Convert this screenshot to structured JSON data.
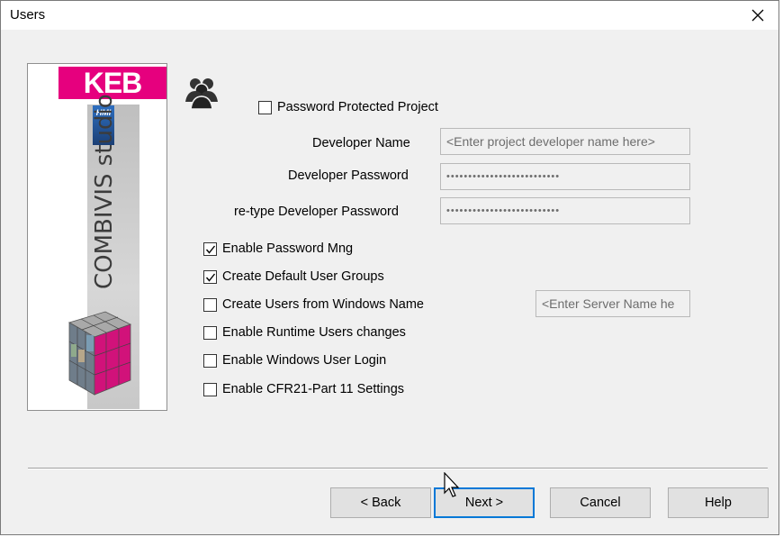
{
  "window": {
    "title": "Users"
  },
  "logo": {
    "brand": "KEB",
    "badge": "HMI",
    "product": "COMBIVIS studio"
  },
  "fields": {
    "password_protected_label": "Password Protected Project",
    "developer_name_label": "Developer Name",
    "developer_name_placeholder": "<Enter project developer name here>",
    "developer_password_label": "Developer Password",
    "developer_password_value": "••••••••••••••••••••••••••",
    "retype_password_label": "re-type Developer Password",
    "retype_password_value": "••••••••••••••••••••••••••",
    "server_name_placeholder": "<Enter Server Name he"
  },
  "options": [
    {
      "label": "Enable Password Mng",
      "checked": true
    },
    {
      "label": "Create Default User Groups",
      "checked": true
    },
    {
      "label": "Create Users from Windows Name",
      "checked": false
    },
    {
      "label": "Enable Runtime Users changes",
      "checked": false
    },
    {
      "label": "Enable Windows User Login",
      "checked": false
    },
    {
      "label": "Enable CFR21-Part 11 Settings",
      "checked": false
    }
  ],
  "password_protected_checked": false,
  "buttons": {
    "back": "< Back",
    "next": "Next >",
    "cancel": "Cancel",
    "help": "Help"
  },
  "colors": {
    "brand": "#e6007e",
    "accent": "#0078d7"
  }
}
